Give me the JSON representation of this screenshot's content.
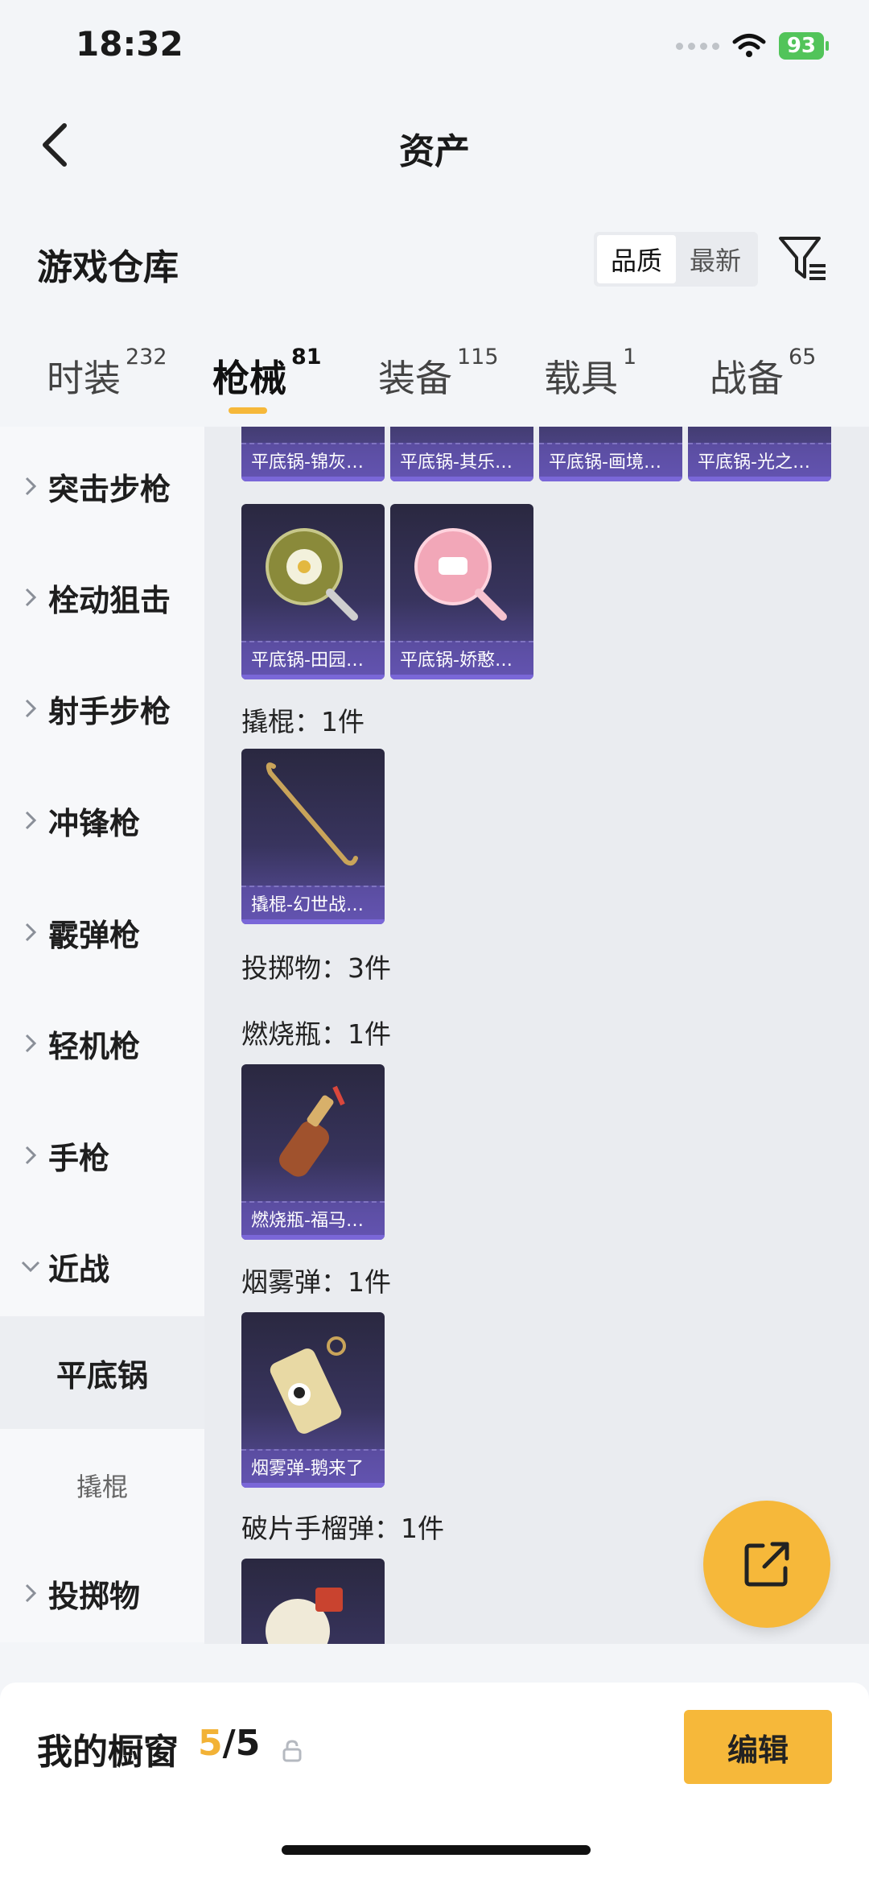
{
  "status": {
    "time": "18:32",
    "battery": "93"
  },
  "nav": {
    "title": "资产"
  },
  "warehouse": {
    "title": "游戏仓库",
    "sort_options": [
      "品质",
      "最新"
    ],
    "sort_active": "品质"
  },
  "tabs": [
    {
      "label": "时装",
      "count": "232"
    },
    {
      "label": "枪械",
      "count": "81"
    },
    {
      "label": "装备",
      "count": "115"
    },
    {
      "label": "载具",
      "count": "1"
    },
    {
      "label": "战备",
      "count": "65"
    }
  ],
  "active_tab": "枪械",
  "sidebar": {
    "items": [
      {
        "label": "突击步枪"
      },
      {
        "label": "栓动狙击"
      },
      {
        "label": "射手步枪"
      },
      {
        "label": "冲锋枪"
      },
      {
        "label": "霰弹枪"
      },
      {
        "label": "轻机枪"
      },
      {
        "label": "手枪"
      },
      {
        "label": "近战"
      },
      {
        "label": "投掷物"
      }
    ],
    "sub_items": [
      {
        "label": "平底锅",
        "selected": true
      },
      {
        "label": "撬棍",
        "selected": false
      }
    ]
  },
  "content": {
    "pan_cards_top": [
      "平底锅-锦灰…",
      "平底锅-其乐…",
      "平底锅-画境…",
      "平底锅-光之…"
    ],
    "pan_cards_row2": [
      "平底锅-田园…",
      "平底锅-娇憨…"
    ],
    "crowbar_section": "撬棍：1件",
    "crowbar_cards": [
      "撬棍-幻世战…"
    ],
    "throwable_section": "投掷物：3件",
    "molotov_section": "燃烧瓶：1件",
    "molotov_cards": [
      "燃烧瓶-福马…"
    ],
    "smoke_section": "烟雾弹：1件",
    "smoke_cards": [
      "烟雾弹-鹅来了"
    ],
    "frag_section": "破片手榴弹：1件"
  },
  "bottom": {
    "showcase_label": "我的橱窗",
    "showcase_current": "5",
    "showcase_total": "/5",
    "edit_label": "编辑"
  },
  "colors": {
    "accent": "#f6b83a",
    "card_purple": "#5b4fa0"
  }
}
